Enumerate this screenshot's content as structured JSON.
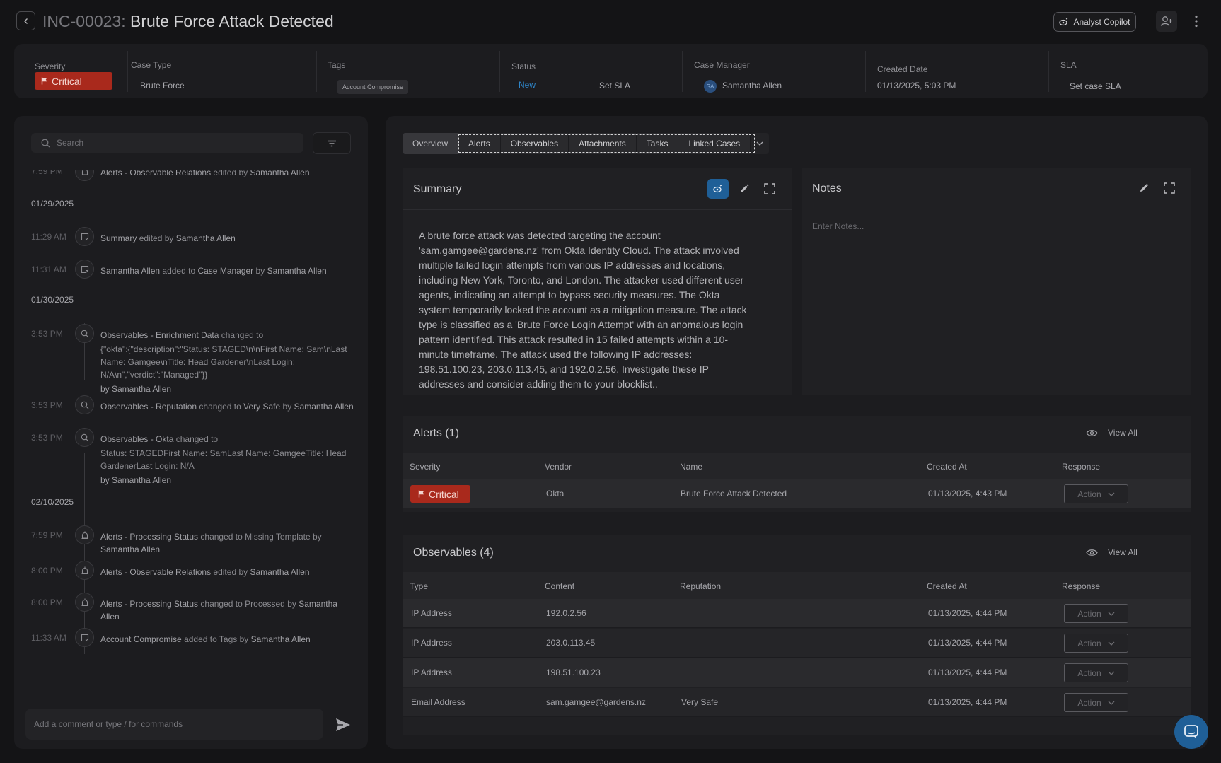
{
  "header": {
    "incident_id": "INC-00023:",
    "incident_title": "Brute Force Attack Detected",
    "copilot_label": "Analyst Copilot"
  },
  "meta": {
    "severity": {
      "label": "Severity",
      "value": "Critical"
    },
    "case_type": {
      "label": "Case Type",
      "value": "Brute Force"
    },
    "tags": {
      "label": "Tags",
      "value": "Account Compromise"
    },
    "status": {
      "label": "Status",
      "value": "New",
      "sla_action": "Set SLA"
    },
    "case_manager": {
      "label": "Case Manager",
      "initials": "SA",
      "value": "Samantha Allen"
    },
    "created_date": {
      "label": "Created Date",
      "value": "01/13/2025, 5:03 PM"
    },
    "sla": {
      "label": "SLA",
      "value": "Set case SLA"
    }
  },
  "activity": {
    "search_placeholder": "Search",
    "comment_placeholder": "Add a comment or type / for commands",
    "partial_top": {
      "time": "7:59 PM",
      "text": "Alerts - Observable Relations",
      "verb": "edited by",
      "by": "Samantha Allen"
    },
    "dates": [
      "01/29/2025",
      "01/30/2025",
      "02/10/2025"
    ],
    "entries": [
      {
        "time": "11:29 AM",
        "subject": "Summary",
        "verb": "edited by",
        "by": "Samantha Allen"
      },
      {
        "time": "11:31 AM",
        "subject": "Samantha Allen",
        "verb": "added to",
        "target": "Case Manager",
        "by_word": "by",
        "by": "Samantha Allen"
      },
      {
        "time": "3:53 PM",
        "subject": "Observables - Enrichment Data",
        "verb": "changed to",
        "detail": "{\"okta\":{\"description\":\"Status: STAGED\\n\\nFirst Name: Sam\\nLast Name: Gamgee\\nTitle: Head Gardener\\nLast Login: N/A\\n\",\"verdict\":\"Managed\"}}",
        "by_line": "by Samantha Allen"
      },
      {
        "time": "3:53 PM",
        "subject": "Observables - Reputation",
        "verb": "changed to",
        "target": "Very Safe",
        "by_word": "by",
        "by": "Samantha Allen"
      },
      {
        "time": "3:53 PM",
        "subject": "Observables - Okta",
        "verb": "changed to",
        "detail": "Status: STAGEDFirst Name: SamLast Name: GamgeeTitle: Head GardenerLast Login: N/A",
        "by_line": "by Samantha Allen"
      },
      {
        "time": "7:59 PM",
        "subject": "Alerts - Processing Status",
        "verb": "changed to",
        "target": "Missing Template",
        "by_word": "by",
        "by": "Samantha Allen"
      },
      {
        "time": "8:00 PM",
        "subject": "Alerts - Observable Relations",
        "verb": "edited by",
        "by": "Samantha Allen"
      },
      {
        "time": "8:00 PM",
        "subject": "Alerts - Processing Status",
        "verb": "changed to",
        "target": "Processed",
        "by_word": "by",
        "by": "Samantha Allen"
      },
      {
        "time": "11:33 AM",
        "subject": "Account Compromise",
        "verb": "added to",
        "target": "Tags",
        "by_word": "by",
        "by": "Samantha Allen"
      }
    ]
  },
  "tabs": [
    "Overview",
    "Alerts",
    "Observables",
    "Attachments",
    "Tasks",
    "Linked Cases"
  ],
  "summary": {
    "title": "Summary",
    "text": "A brute force attack was detected targeting the account 'sam.gamgee@gardens.nz' from Okta Identity Cloud. The attack involved multiple failed login attempts from various IP addresses and locations, including New York, Toronto, and London. The attacker used different user agents, indicating an attempt to bypass security measures.  The Okta system temporarily locked the account as a mitigation measure. The attack type is classified as a 'Brute Force Login Attempt' with an anomalous login pattern identified. This attack resulted in 15 failed attempts within a 10-minute timeframe.  The attack used the following IP addresses: 198.51.100.23, 203.0.113.45, and 192.0.2.56.  Investigate these IP addresses and consider adding them to your blocklist.."
  },
  "notes": {
    "title": "Notes",
    "placeholder": "Enter Notes..."
  },
  "alerts": {
    "title": "Alerts (1)",
    "view_all": "View All",
    "columns": [
      "Severity",
      "Vendor",
      "Name",
      "Created At",
      "Response"
    ],
    "rows": [
      {
        "severity": "Critical",
        "vendor": "Okta",
        "name": "Brute Force Attack Detected",
        "created_at": "01/13/2025, 4:43 PM",
        "action": "Action"
      }
    ]
  },
  "observables": {
    "title": "Observables (4)",
    "view_all": "View All",
    "columns": [
      "Type",
      "Content",
      "Reputation",
      "Created At",
      "Response"
    ],
    "rows": [
      {
        "type": "IP Address",
        "content": "192.0.2.56",
        "reputation": "",
        "created_at": "01/13/2025, 4:44 PM",
        "action": "Action"
      },
      {
        "type": "IP Address",
        "content": "203.0.113.45",
        "reputation": "",
        "created_at": "01/13/2025, 4:44 PM",
        "action": "Action"
      },
      {
        "type": "IP Address",
        "content": "198.51.100.23",
        "reputation": "",
        "created_at": "01/13/2025, 4:44 PM",
        "action": "Action"
      },
      {
        "type": "Email Address",
        "content": "sam.gamgee@gardens.nz",
        "reputation": "Very Safe",
        "created_at": "01/13/2025, 4:44 PM",
        "action": "Action"
      }
    ]
  },
  "colors": {
    "critical": "#a9291c",
    "accent": "#1f5f97",
    "status_new": "#2f86c9"
  }
}
